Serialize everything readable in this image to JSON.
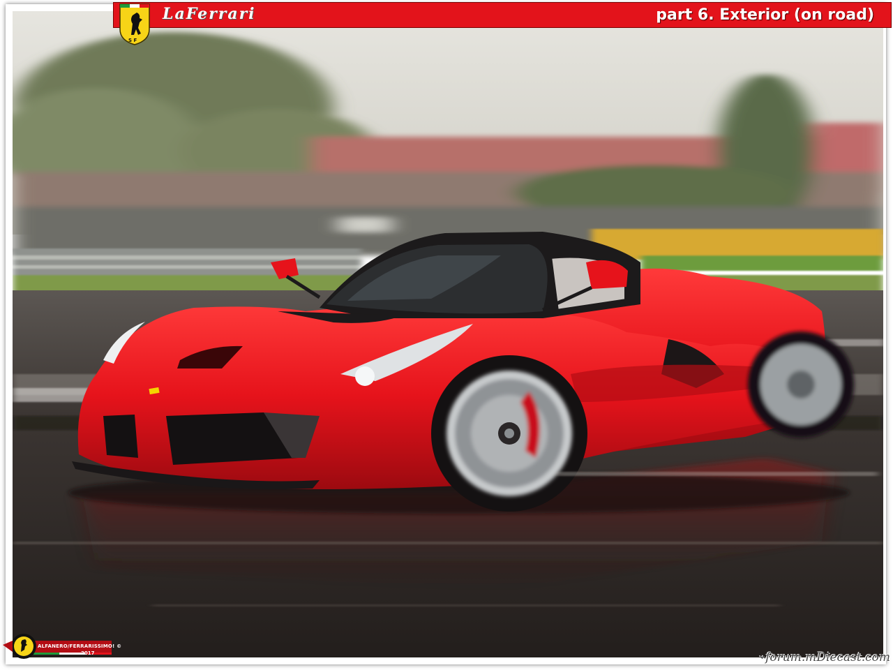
{
  "header": {
    "brand_title": "LaFerrari",
    "section_label": "part 6. Exterior (on road)"
  },
  "badge": {
    "credit": "ALFANERO/FERRARISSIMO! ©",
    "year": "2017"
  },
  "watermark": {
    "text": "forum.mDiecast.com"
  },
  "photo": {
    "subject": "red-hypercar-on-wet-track",
    "colors": {
      "car_red": "#e8141c",
      "roof_black": "#1c1a1b",
      "sky": "#dedcd4",
      "asphalt": "#2f2a27"
    }
  },
  "icons": [
    "prancing-horse-shield-icon",
    "badge-shield-icon",
    "watermark-car-icon"
  ]
}
